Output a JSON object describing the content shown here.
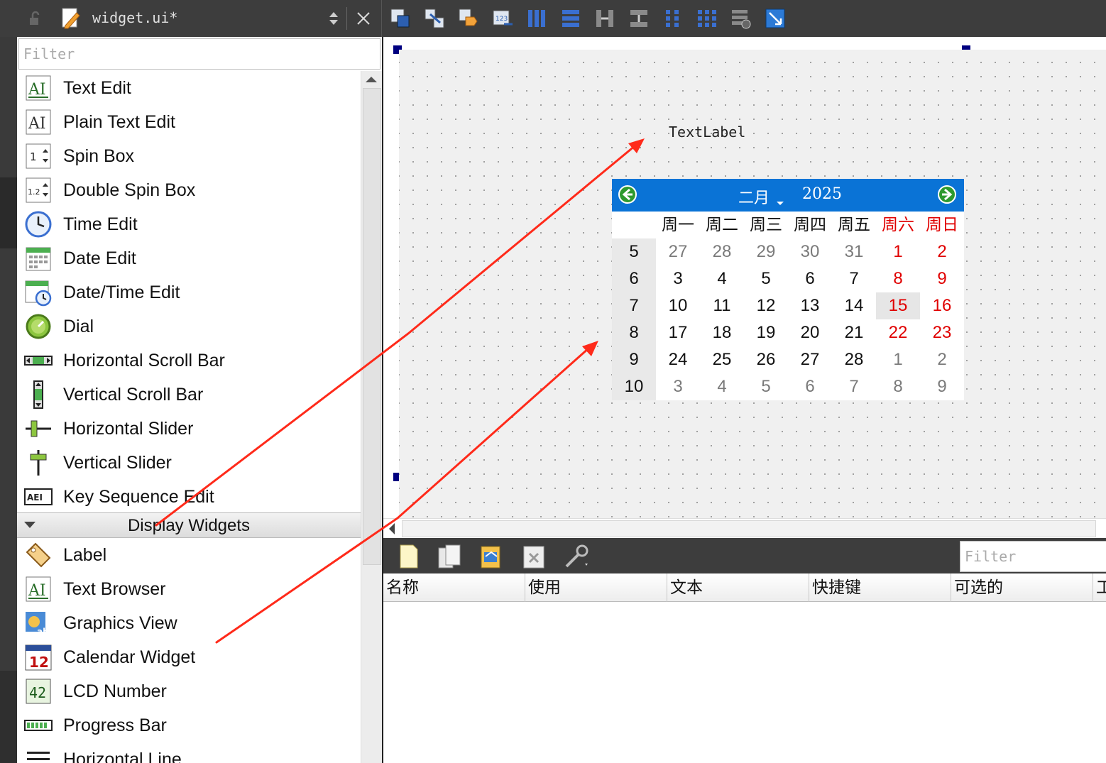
{
  "editor": {
    "filename": "widget.ui*",
    "tools": [
      "edit-widgets-icon",
      "edit-signals-slots-icon",
      "edit-buddies-icon",
      "edit-tab-order-icon",
      "layout-horizontal-icon",
      "layout-vertical-icon",
      "layout-horizontal-splitter-icon",
      "layout-vertical-splitter-icon",
      "layout-form-icon",
      "layout-grid-icon",
      "break-layout-icon",
      "adjust-size-icon"
    ]
  },
  "widgetbox": {
    "filter_placeholder": "Filter",
    "items_top": [
      {
        "label": "Text Edit",
        "icon": "text-edit-icon"
      },
      {
        "label": "Plain Text Edit",
        "icon": "plain-text-edit-icon"
      },
      {
        "label": "Spin Box",
        "icon": "spin-box-icon"
      },
      {
        "label": "Double Spin Box",
        "icon": "double-spin-box-icon"
      },
      {
        "label": "Time Edit",
        "icon": "time-edit-icon"
      },
      {
        "label": "Date Edit",
        "icon": "date-edit-icon"
      },
      {
        "label": "Date/Time Edit",
        "icon": "datetime-edit-icon"
      },
      {
        "label": "Dial",
        "icon": "dial-icon"
      },
      {
        "label": "Horizontal Scroll Bar",
        "icon": "hscrollbar-icon"
      },
      {
        "label": "Vertical Scroll Bar",
        "icon": "vscrollbar-icon"
      },
      {
        "label": "Horizontal Slider",
        "icon": "hslider-icon"
      },
      {
        "label": "Vertical Slider",
        "icon": "vslider-icon"
      },
      {
        "label": "Key Sequence Edit",
        "icon": "key-sequence-icon"
      }
    ],
    "category": "Display Widgets",
    "items_bottom": [
      {
        "label": "Label",
        "icon": "label-icon"
      },
      {
        "label": "Text Browser",
        "icon": "text-browser-icon"
      },
      {
        "label": "Graphics View",
        "icon": "graphics-view-icon"
      },
      {
        "label": "Calendar Widget",
        "icon": "calendar-widget-icon"
      },
      {
        "label": "LCD Number",
        "icon": "lcd-number-icon"
      },
      {
        "label": "Progress Bar",
        "icon": "progress-bar-icon"
      },
      {
        "label": "Horizontal Line",
        "icon": "horizontal-line-icon"
      }
    ]
  },
  "form": {
    "text_label": "TextLabel"
  },
  "calendar": {
    "month": "二月",
    "year": "2025",
    "weekdays": [
      "周一",
      "周二",
      "周三",
      "周四",
      "周五",
      "周六",
      "周日"
    ],
    "weeks": [
      "5",
      "6",
      "7",
      "8",
      "9",
      "10"
    ],
    "days": [
      [
        "27",
        "28",
        "29",
        "30",
        "31",
        "1",
        "2"
      ],
      [
        "3",
        "4",
        "5",
        "6",
        "7",
        "8",
        "9"
      ],
      [
        "10",
        "11",
        "12",
        "13",
        "14",
        "15",
        "16"
      ],
      [
        "17",
        "18",
        "19",
        "20",
        "21",
        "22",
        "23"
      ],
      [
        "24",
        "25",
        "26",
        "27",
        "28",
        "1",
        "2"
      ],
      [
        "3",
        "4",
        "5",
        "6",
        "7",
        "8",
        "9"
      ]
    ],
    "selected": "15",
    "colors": {
      "header": "#0a73d6",
      "weekend": "#e00000",
      "other_month": "#7a7a7a"
    }
  },
  "action_editor": {
    "filter_placeholder": "Filter",
    "columns": [
      "名称",
      "使用",
      "文本",
      "快捷键",
      "可选的",
      "工"
    ],
    "tools": [
      "new-action-icon",
      "copy-action-icon",
      "paste-action-icon",
      "delete-action-icon",
      "configure-icon"
    ]
  },
  "annotation_color": "#ff2a1a"
}
